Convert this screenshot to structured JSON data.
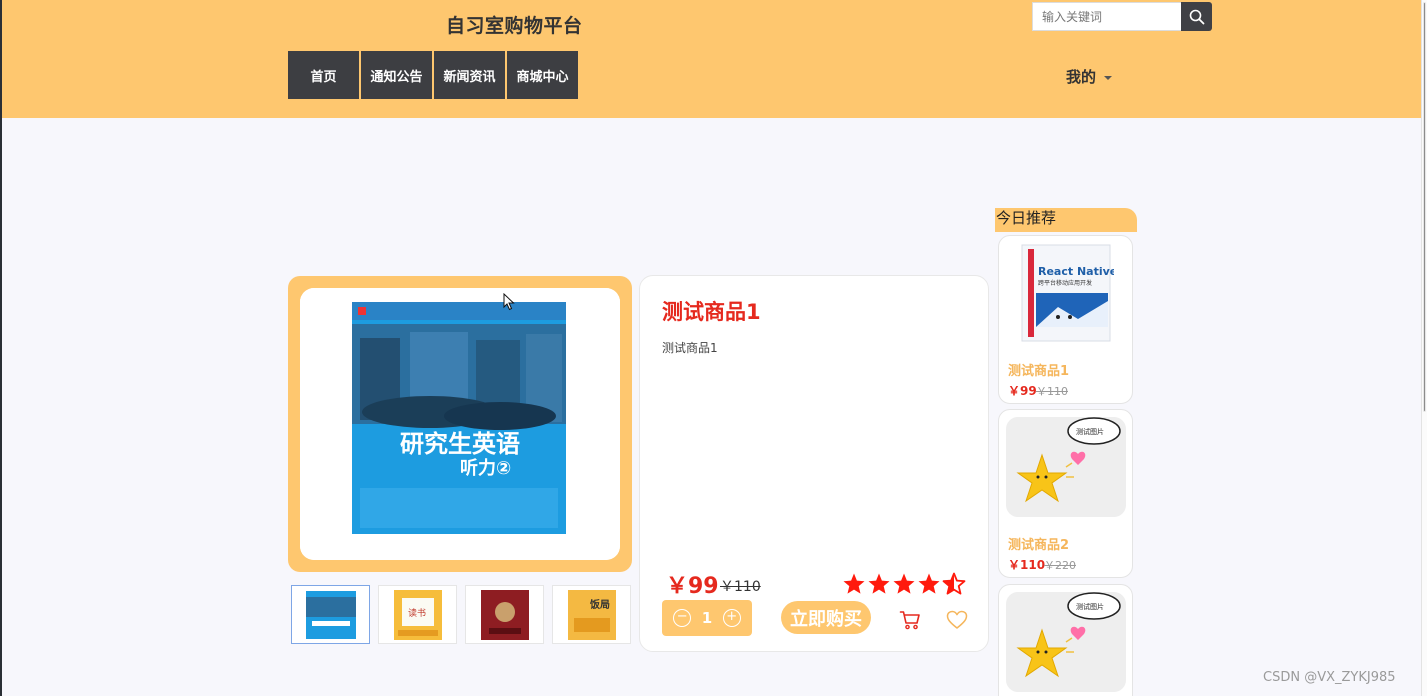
{
  "header": {
    "site_title": "自习室购物平台",
    "search_placeholder": "输入关键词",
    "nav": [
      "首页",
      "通知公告",
      "新闻资讯",
      "商城中心"
    ],
    "my_menu": "我的"
  },
  "product": {
    "title": "测试商品1",
    "description": "测试商品1",
    "price": "￥99",
    "old_price": "￥110",
    "rating": 4.5,
    "quantity": "1",
    "buy_label": "立即购买",
    "cover_title": "研究生英语",
    "cover_subtitle": "听力②",
    "thumb_2_title": "读书",
    "thumb_4_title": "饭局"
  },
  "recommend": {
    "title": "今日推荐",
    "items": [
      {
        "name": "测试商品1",
        "price": "￥99",
        "old_price": "￥110",
        "cover_title": "React Native",
        "cover_subtitle": "跨平台移动应用开发"
      },
      {
        "name": "测试商品2",
        "price": "￥110",
        "old_price": "￥220",
        "bubble": "测试图片"
      },
      {
        "bubble": "测试图片"
      }
    ]
  },
  "watermark": "CSDN @VX_ZYKJ985",
  "colors": {
    "accent": "#fec76f",
    "nav_bg": "#3d3e42",
    "price_red": "#e5291e",
    "star_red": "#ff1a0d"
  }
}
